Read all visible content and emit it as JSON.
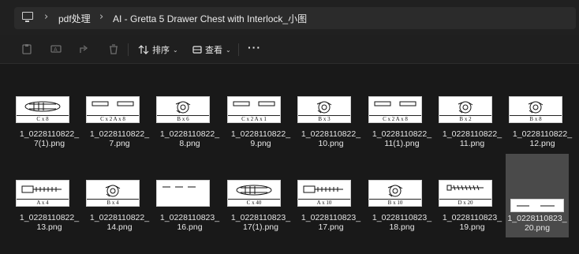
{
  "breadcrumb": {
    "items": [
      "pdf处理",
      "AI - Gretta 5 Drawer Chest with Interlock_小图"
    ]
  },
  "toolbar": {
    "sort_label": "排序",
    "view_label": "查看",
    "more_label": "···"
  },
  "files": [
    {
      "line1": "1_0228110822_",
      "line2": "7(1).png",
      "caption": "C x 8",
      "kind": "plug"
    },
    {
      "line1": "1_0228110822_",
      "line2": "7.png",
      "caption": "C x 2      A x 8",
      "kind": "strip"
    },
    {
      "line1": "1_0228110822_",
      "line2": "8.png",
      "caption": "B x 6",
      "kind": "cam"
    },
    {
      "line1": "1_0228110822_",
      "line2": "9.png",
      "caption": "C x 2      A x 1",
      "kind": "strip"
    },
    {
      "line1": "1_0228110822_",
      "line2": "10.png",
      "caption": "B x 3",
      "kind": "cam"
    },
    {
      "line1": "1_0228110822_",
      "line2": "11(1).png",
      "caption": "C x 2      A x 8",
      "kind": "strip"
    },
    {
      "line1": "1_0228110822_",
      "line2": "11.png",
      "caption": "B x 2",
      "kind": "cam"
    },
    {
      "line1": "1_0228110822_",
      "line2": "12.png",
      "caption": "B x 8",
      "kind": "cam"
    },
    {
      "line1": "1_0228110822_",
      "line2": "13.png",
      "caption": "A x 4",
      "kind": "bolt"
    },
    {
      "line1": "1_0228110822_",
      "line2": "14.png",
      "caption": "B x 4",
      "kind": "cam"
    },
    {
      "line1": "1_0228110823_",
      "line2": "16.png",
      "caption": "",
      "kind": "tiny"
    },
    {
      "line1": "1_0228110823_",
      "line2": "17(1).png",
      "caption": "C x 40",
      "kind": "plug"
    },
    {
      "line1": "1_0228110823_",
      "line2": "17.png",
      "caption": "A x 10",
      "kind": "bolt"
    },
    {
      "line1": "1_0228110823_",
      "line2": "18.png",
      "caption": "B x 10",
      "kind": "cam"
    },
    {
      "line1": "1_0228110823_",
      "line2": "19.png",
      "caption": "D x 20",
      "kind": "screw"
    },
    {
      "line1": "1_0228110823_",
      "line2": "20.png",
      "caption": "",
      "kind": "tiny2",
      "selected": true
    }
  ]
}
